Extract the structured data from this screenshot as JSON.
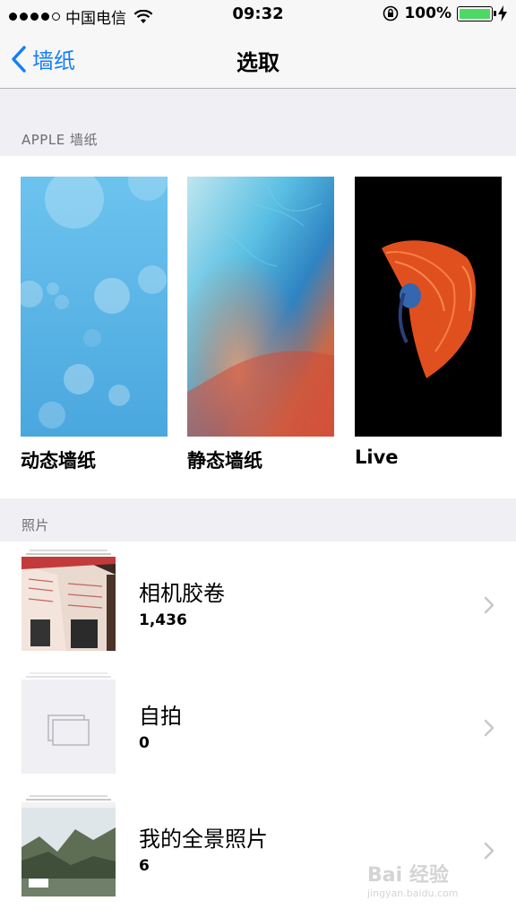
{
  "status_bar": {
    "carrier": "中国电信",
    "time": "09:32",
    "battery": "100%",
    "battery_level": 1.0,
    "signal_dots_filled": 4
  },
  "nav": {
    "back_label": "墙纸",
    "title": "选取"
  },
  "sections": {
    "apple_header": "APPLE 墙纸",
    "photos_header": "照片"
  },
  "wallpapers": [
    {
      "label": "动态墙纸"
    },
    {
      "label": "静态墙纸"
    },
    {
      "label": "Live"
    }
  ],
  "albums": [
    {
      "title": "相机胶卷",
      "count": "1,436"
    },
    {
      "title": "自拍",
      "count": "0"
    },
    {
      "title": "我的全景照片",
      "count": "6"
    }
  ],
  "watermark": {
    "line1": "Bai 经验",
    "line2": "jingyan.baidu.com"
  },
  "colors": {
    "accent": "#157efb",
    "battery_green": "#4cd964",
    "group_bg": "#efeff4",
    "section_text": "#6d6d72"
  },
  "icons": [
    "wifi-icon",
    "orientation-lock-icon",
    "battery-icon",
    "charging-bolt-icon",
    "back-chevron-icon",
    "disclosure-chevron-icon",
    "empty-album-icon"
  ]
}
